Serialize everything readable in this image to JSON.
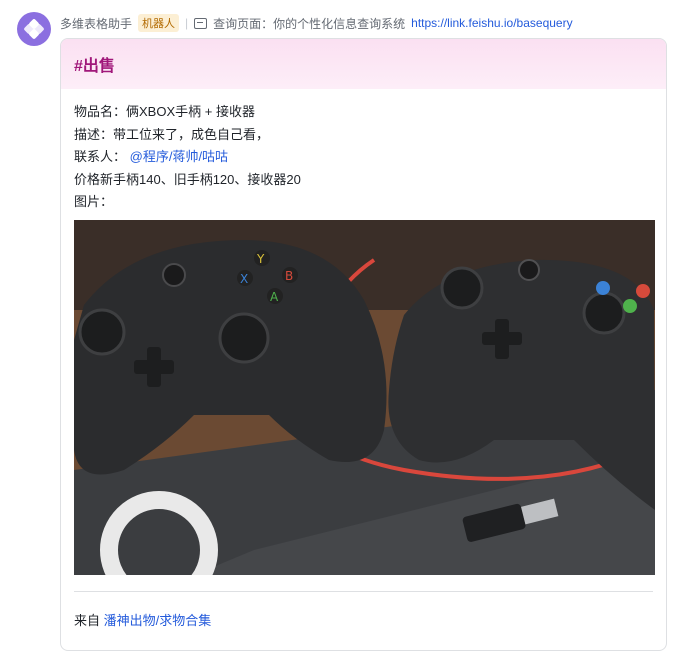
{
  "header": {
    "bot_name": "多维表格助手",
    "bot_badge": "机器人",
    "query_label": "查询页面：你的个性化信息查询系统",
    "query_link": "https://link.feishu.io/basequery",
    "avatar_icon": "bitable-logo-icon",
    "page_icon": "document-icon"
  },
  "card": {
    "title": "#出售",
    "item_label": "物品名：",
    "item_value": "俩XBOX手柄 + 接收器",
    "desc_label": "描述：",
    "desc_value": "带工位来了，成色自己看，",
    "contact_label": "联系人：",
    "contact_value": "@程序/蒋帅/咕咕",
    "price_line": "价格新手柄140、旧手柄120、接收器20",
    "image_label": "图片：",
    "image_alt": "two-xbox-controllers-photo",
    "footer_prefix": "来自",
    "footer_source": "潘神出物/求物合集"
  },
  "colors": {
    "accent": "#245bdb",
    "title": "#a0177a",
    "header_bg": "#fbe0f2"
  }
}
